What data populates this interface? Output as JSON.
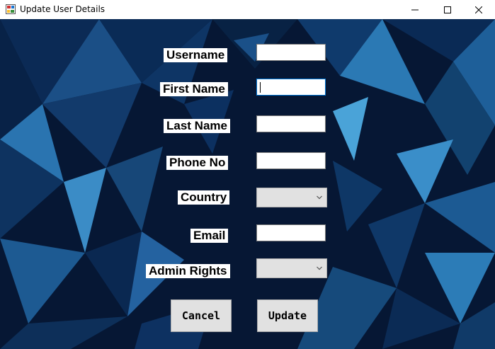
{
  "window": {
    "title": "Update User Details",
    "icon": "app-form-icon",
    "controls": [
      "minimize-icon",
      "maximize-icon",
      "close-icon"
    ]
  },
  "form": {
    "username": {
      "label": "Username",
      "value": ""
    },
    "first_name": {
      "label": "First Name",
      "value": ""
    },
    "last_name": {
      "label": "Last Name",
      "value": ""
    },
    "phone": {
      "label": "Phone No",
      "value": ""
    },
    "country": {
      "label": "Country",
      "selected": ""
    },
    "email": {
      "label": "Email",
      "value": ""
    },
    "admin_rights": {
      "label": "Admin Rights",
      "selected": ""
    }
  },
  "buttons": {
    "cancel": "Cancel",
    "update": "Update"
  },
  "colors": {
    "background": "#061734",
    "label_bg": "#ffffff",
    "focus_border": "#0078d7",
    "button_bg": "#e1e1e1"
  }
}
